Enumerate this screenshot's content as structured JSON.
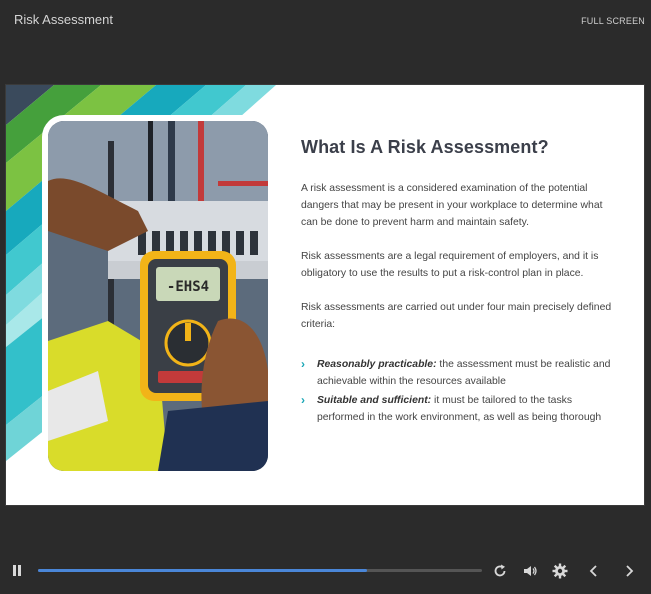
{
  "header": {
    "course_title": "Risk Assessment",
    "fullscreen_label": "FULL SCREEN"
  },
  "slide": {
    "heading": "What Is A Risk Assessment?",
    "paragraphs": [
      "A risk assessment is a considered examination of the potential dangers that may be present in your workplace to determine what can be done to prevent harm and maintain safety.",
      "Risk assessments are a legal requirement of employers, and it is obligatory to use the results to put a risk-control plan in place.",
      "Risk assessments are carried out under four main precisely defined criteria:"
    ],
    "bullets": [
      {
        "term": "Reasonably practicable:",
        "text": " the assessment must be realistic and achievable within the resources available"
      },
      {
        "term": "Suitable and sufficient:",
        "text": " it must be tailored to the tasks performed in the work environment, as well as being thorough"
      }
    ],
    "meter_display": "-EHS4"
  },
  "player": {
    "progress": 0.74,
    "icons": [
      "pause-icon",
      "replay-icon",
      "volume-icon",
      "settings-icon",
      "previous-icon",
      "next-icon"
    ]
  },
  "colors": {
    "background": "#2b2b2b",
    "accent_teal": "#1ba7b6",
    "accent_green": "#6cc04a",
    "progress_blue": "#4a86d8"
  }
}
